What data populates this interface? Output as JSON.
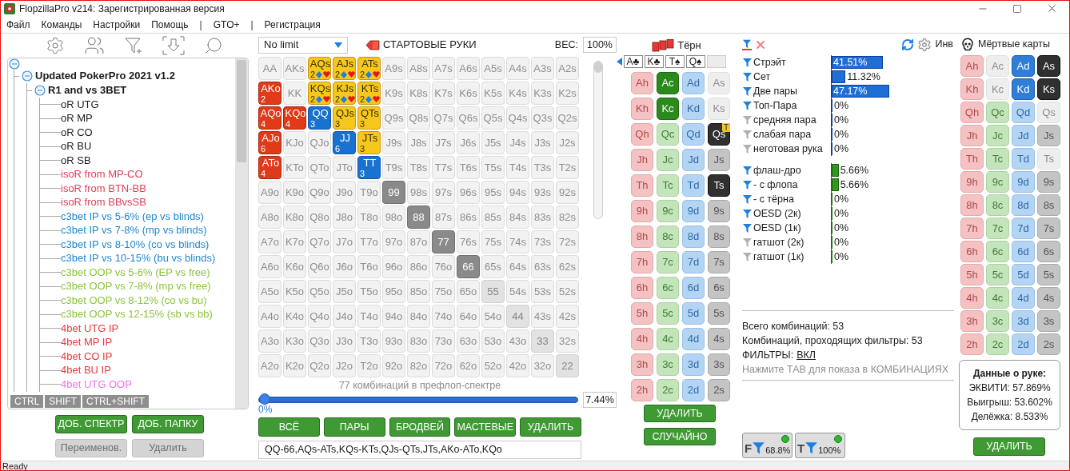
{
  "window": {
    "title": "FlopzillaPro v214: Зарегистрированная версия"
  },
  "menu": [
    {
      "kind": "item",
      "label": "Файл"
    },
    {
      "kind": "item",
      "label": "Команды"
    },
    {
      "kind": "item",
      "label": "Настройки"
    },
    {
      "kind": "item",
      "label": "Помощь"
    },
    {
      "kind": "separator",
      "label": "|"
    },
    {
      "kind": "item",
      "label": "GTO+"
    },
    {
      "kind": "separator",
      "label": "|"
    },
    {
      "kind": "item",
      "label": "Регистрация"
    }
  ],
  "ranges_panel": {
    "tree": {
      "expanded": true,
      "children": [
        {
          "label": "Updated PokerPro 2021 v1.2",
          "expanded": true,
          "children": [
            {
              "label": "R1 and vs 3BET",
              "expanded": true,
              "children": [
                {
                  "label": "oR UTG",
                  "color": "#1a1a1a"
                },
                {
                  "label": "oR MP",
                  "color": "#1a1a1a"
                },
                {
                  "label": "oR CO",
                  "color": "#1a1a1a"
                },
                {
                  "label": "oR BU",
                  "color": "#1a1a1a"
                },
                {
                  "label": "oR SB",
                  "color": "#1a1a1a"
                },
                {
                  "label": "isoR from MP-CO",
                  "color": "#e0405a"
                },
                {
                  "label": "isoR from BTN-BB",
                  "color": "#e0405a"
                },
                {
                  "label": "isoR from BBvsSB",
                  "color": "#e0405a"
                },
                {
                  "label": "c3bet IP vs 5-6% (ep vs blinds)",
                  "color": "#1e88d0"
                },
                {
                  "label": "c3bet IP vs 7-8% (mp vs blinds)",
                  "color": "#1e88d0"
                },
                {
                  "label": "c3bet IP vs 8-10% (co vs blinds)",
                  "color": "#1e88d0"
                },
                {
                  "label": "c3bet IP vs 10-15% (bu vs blinds)",
                  "color": "#1e88d0"
                },
                {
                  "label": "c3bet OOP vs 5-6% (EP vs free)",
                  "color": "#8cc43a"
                },
                {
                  "label": "c3bet OOP vs 7-8% (mp vs free)",
                  "color": "#8cc43a"
                },
                {
                  "label": "c3bet OOP vs 8-12% (co vs bu)",
                  "color": "#8cc43a"
                },
                {
                  "label": "c3bet OOP vs 12-15% (sb vs bb)",
                  "color": "#8cc43a"
                },
                {
                  "label": "4bet UTG IP",
                  "color": "#e83a3a"
                },
                {
                  "label": "4bet MP IP",
                  "color": "#e83a3a"
                },
                {
                  "label": "4bet CO IP",
                  "color": "#e83a3a"
                },
                {
                  "label": "4bet BU IP",
                  "color": "#e83a3a"
                },
                {
                  "label": "4bet UTG OOP",
                  "color": "#ee70ee"
                }
              ]
            }
          ]
        }
      ]
    },
    "modifier_tabs": [
      "CTRL",
      "SHIFT",
      "CTRL+SHIFT"
    ],
    "buttons": [
      {
        "label": "ДОБ. СПЕКТР",
        "disabled": false
      },
      {
        "label": "ДОБ. ПАПКУ",
        "disabled": false
      },
      {
        "label": "Переименов.",
        "disabled": true
      },
      {
        "label": "Удалить",
        "disabled": true
      }
    ]
  },
  "hand_grid": {
    "game_select": "No limit",
    "title": "СТАРТОВЫЕ РУКИ",
    "weight_label": "ВЕС:",
    "weight_value": "100%",
    "weight_slider": {
      "level": 1
    },
    "rows": [
      [
        {
          "label": "AA",
          "kind": "empty"
        },
        {
          "label": "AKs",
          "kind": "empty"
        },
        {
          "label": "AQs",
          "kind": "suited_mixed",
          "count": "2"
        },
        {
          "label": "AJs",
          "kind": "suited_mixed",
          "count": "2"
        },
        {
          "label": "ATs",
          "kind": "suited_mixed",
          "count": "2"
        },
        {
          "label": "A9s",
          "kind": "empty"
        },
        {
          "label": "A8s",
          "kind": "empty"
        },
        {
          "label": "A7s",
          "kind": "empty"
        },
        {
          "label": "A6s",
          "kind": "empty"
        },
        {
          "label": "A5s",
          "kind": "empty"
        },
        {
          "label": "A4s",
          "kind": "empty"
        },
        {
          "label": "A3s",
          "kind": "empty"
        },
        {
          "label": "A2s",
          "kind": "empty"
        }
      ],
      [
        {
          "label": "AKo",
          "kind": "offsuit",
          "count": "2"
        },
        {
          "label": "KK",
          "kind": "empty"
        },
        {
          "label": "KQs",
          "kind": "suited_mixed",
          "count": "2"
        },
        {
          "label": "KJs",
          "kind": "suited_mixed",
          "count": "2"
        },
        {
          "label": "KTs",
          "kind": "suited_mixed",
          "count": "2"
        },
        {
          "label": "K9s",
          "kind": "empty"
        },
        {
          "label": "K8s",
          "kind": "empty"
        },
        {
          "label": "K7s",
          "kind": "empty"
        },
        {
          "label": "K6s",
          "kind": "empty"
        },
        {
          "label": "K5s",
          "kind": "empty"
        },
        {
          "label": "K4s",
          "kind": "empty"
        },
        {
          "label": "K3s",
          "kind": "empty"
        },
        {
          "label": "K2s",
          "kind": "empty"
        }
      ],
      [
        {
          "label": "AQo",
          "kind": "offsuit",
          "count": "4"
        },
        {
          "label": "KQo",
          "kind": "offsuit",
          "count": "4"
        },
        {
          "label": "QQ",
          "kind": "pair",
          "count": "3"
        },
        {
          "label": "QJs",
          "kind": "suited",
          "count": "3"
        },
        {
          "label": "QTs",
          "kind": "suited",
          "count": "3"
        },
        {
          "label": "Q9s",
          "kind": "empty"
        },
        {
          "label": "Q8s",
          "kind": "empty"
        },
        {
          "label": "Q7s",
          "kind": "empty"
        },
        {
          "label": "Q6s",
          "kind": "empty"
        },
        {
          "label": "Q5s",
          "kind": "empty"
        },
        {
          "label": "Q4s",
          "kind": "empty"
        },
        {
          "label": "Q3s",
          "kind": "empty"
        },
        {
          "label": "Q2s",
          "kind": "empty"
        }
      ],
      [
        {
          "label": "AJo",
          "kind": "offsuit",
          "count": "6"
        },
        {
          "label": "KJo",
          "kind": "empty"
        },
        {
          "label": "QJo",
          "kind": "empty"
        },
        {
          "label": "JJ",
          "kind": "pair",
          "count": "6"
        },
        {
          "label": "JTs",
          "kind": "suited",
          "count": "3"
        },
        {
          "label": "J9s",
          "kind": "empty"
        },
        {
          "label": "J8s",
          "kind": "empty"
        },
        {
          "label": "J7s",
          "kind": "empty"
        },
        {
          "label": "J6s",
          "kind": "empty"
        },
        {
          "label": "J5s",
          "kind": "empty"
        },
        {
          "label": "J4s",
          "kind": "empty"
        },
        {
          "label": "J3s",
          "kind": "empty"
        },
        {
          "label": "J2s",
          "kind": "empty"
        }
      ],
      [
        {
          "label": "ATo",
          "kind": "offsuit",
          "count": "4"
        },
        {
          "label": "KTo",
          "kind": "empty"
        },
        {
          "label": "QTo",
          "kind": "empty"
        },
        {
          "label": "JTo",
          "kind": "empty"
        },
        {
          "label": "TT",
          "kind": "pair",
          "count": "3"
        },
        {
          "label": "T9s",
          "kind": "empty"
        },
        {
          "label": "T8s",
          "kind": "empty"
        },
        {
          "label": "T7s",
          "kind": "empty"
        },
        {
          "label": "T6s",
          "kind": "empty"
        },
        {
          "label": "T5s",
          "kind": "empty"
        },
        {
          "label": "T4s",
          "kind": "empty"
        },
        {
          "label": "T3s",
          "kind": "empty"
        },
        {
          "label": "T2s",
          "kind": "empty"
        }
      ],
      [
        {
          "label": "A9o",
          "kind": "empty"
        },
        {
          "label": "K9o",
          "kind": "empty"
        },
        {
          "label": "Q9o",
          "kind": "empty"
        },
        {
          "label": "J9o",
          "kind": "empty"
        },
        {
          "label": "T9o",
          "kind": "empty"
        },
        {
          "label": "99",
          "kind": "dead"
        },
        {
          "label": "98s",
          "kind": "empty"
        },
        {
          "label": "97s",
          "kind": "empty"
        },
        {
          "label": "96s",
          "kind": "empty"
        },
        {
          "label": "95s",
          "kind": "empty"
        },
        {
          "label": "94s",
          "kind": "empty"
        },
        {
          "label": "93s",
          "kind": "empty"
        },
        {
          "label": "92s",
          "kind": "empty"
        }
      ],
      [
        {
          "label": "A8o",
          "kind": "empty"
        },
        {
          "label": "K8o",
          "kind": "empty"
        },
        {
          "label": "Q8o",
          "kind": "empty"
        },
        {
          "label": "J8o",
          "kind": "empty"
        },
        {
          "label": "T8o",
          "kind": "empty"
        },
        {
          "label": "98o",
          "kind": "empty"
        },
        {
          "label": "88",
          "kind": "dead"
        },
        {
          "label": "87s",
          "kind": "empty"
        },
        {
          "label": "86s",
          "kind": "empty"
        },
        {
          "label": "85s",
          "kind": "empty"
        },
        {
          "label": "84s",
          "kind": "empty"
        },
        {
          "label": "83s",
          "kind": "empty"
        },
        {
          "label": "82s",
          "kind": "empty"
        }
      ],
      [
        {
          "label": "A7o",
          "kind": "empty"
        },
        {
          "label": "K7o",
          "kind": "empty"
        },
        {
          "label": "Q7o",
          "kind": "empty"
        },
        {
          "label": "J7o",
          "kind": "empty"
        },
        {
          "label": "T7o",
          "kind": "empty"
        },
        {
          "label": "97o",
          "kind": "empty"
        },
        {
          "label": "87o",
          "kind": "empty"
        },
        {
          "label": "77",
          "kind": "dead"
        },
        {
          "label": "76s",
          "kind": "empty"
        },
        {
          "label": "75s",
          "kind": "empty"
        },
        {
          "label": "74s",
          "kind": "empty"
        },
        {
          "label": "73s",
          "kind": "empty"
        },
        {
          "label": "72s",
          "kind": "empty"
        }
      ],
      [
        {
          "label": "A6o",
          "kind": "empty"
        },
        {
          "label": "K6o",
          "kind": "empty"
        },
        {
          "label": "Q6o",
          "kind": "empty"
        },
        {
          "label": "J6o",
          "kind": "empty"
        },
        {
          "label": "T6o",
          "kind": "empty"
        },
        {
          "label": "96o",
          "kind": "empty"
        },
        {
          "label": "86o",
          "kind": "empty"
        },
        {
          "label": "76o",
          "kind": "empty"
        },
        {
          "label": "66",
          "kind": "dead"
        },
        {
          "label": "65s",
          "kind": "empty"
        },
        {
          "label": "64s",
          "kind": "empty"
        },
        {
          "label": "63s",
          "kind": "empty"
        },
        {
          "label": "62s",
          "kind": "empty"
        }
      ],
      [
        {
          "label": "A5o",
          "kind": "empty"
        },
        {
          "label": "K5o",
          "kind": "empty"
        },
        {
          "label": "Q5o",
          "kind": "empty"
        },
        {
          "label": "J5o",
          "kind": "empty"
        },
        {
          "label": "T5o",
          "kind": "empty"
        },
        {
          "label": "95o",
          "kind": "empty"
        },
        {
          "label": "85o",
          "kind": "empty"
        },
        {
          "label": "75o",
          "kind": "empty"
        },
        {
          "label": "65o",
          "kind": "empty"
        },
        {
          "label": "55",
          "kind": "dim"
        },
        {
          "label": "54s",
          "kind": "empty"
        },
        {
          "label": "53s",
          "kind": "empty"
        },
        {
          "label": "52s",
          "kind": "empty"
        }
      ],
      [
        {
          "label": "A4o",
          "kind": "empty"
        },
        {
          "label": "K4o",
          "kind": "empty"
        },
        {
          "label": "Q4o",
          "kind": "empty"
        },
        {
          "label": "J4o",
          "kind": "empty"
        },
        {
          "label": "T4o",
          "kind": "empty"
        },
        {
          "label": "94o",
          "kind": "empty"
        },
        {
          "label": "84o",
          "kind": "empty"
        },
        {
          "label": "74o",
          "kind": "empty"
        },
        {
          "label": "64o",
          "kind": "empty"
        },
        {
          "label": "54o",
          "kind": "empty"
        },
        {
          "label": "44",
          "kind": "dim"
        },
        {
          "label": "43s",
          "kind": "empty"
        },
        {
          "label": "42s",
          "kind": "empty"
        }
      ],
      [
        {
          "label": "A3o",
          "kind": "empty"
        },
        {
          "label": "K3o",
          "kind": "empty"
        },
        {
          "label": "Q3o",
          "kind": "empty"
        },
        {
          "label": "J3o",
          "kind": "empty"
        },
        {
          "label": "T3o",
          "kind": "empty"
        },
        {
          "label": "93o",
          "kind": "empty"
        },
        {
          "label": "83o",
          "kind": "empty"
        },
        {
          "label": "73o",
          "kind": "empty"
        },
        {
          "label": "63o",
          "kind": "empty"
        },
        {
          "label": "53o",
          "kind": "empty"
        },
        {
          "label": "43o",
          "kind": "empty"
        },
        {
          "label": "33",
          "kind": "dim"
        },
        {
          "label": "32s",
          "kind": "empty"
        }
      ],
      [
        {
          "label": "A2o",
          "kind": "empty"
        },
        {
          "label": "K2o",
          "kind": "empty"
        },
        {
          "label": "Q2o",
          "kind": "empty"
        },
        {
          "label": "J2o",
          "kind": "empty"
        },
        {
          "label": "T2o",
          "kind": "empty"
        },
        {
          "label": "92o",
          "kind": "empty"
        },
        {
          "label": "82o",
          "kind": "empty"
        },
        {
          "label": "72o",
          "kind": "empty"
        },
        {
          "label": "62o",
          "kind": "empty"
        },
        {
          "label": "52o",
          "kind": "empty"
        },
        {
          "label": "42o",
          "kind": "empty"
        },
        {
          "label": "32o",
          "kind": "empty"
        },
        {
          "label": "22",
          "kind": "dim"
        }
      ]
    ],
    "combo_caption": "77 комбинаций в префлоп-спектре",
    "slider": {
      "level": 0
    },
    "slider_reading": "0%",
    "percent_value": "7.44%",
    "buttons": [
      "ВСЁ",
      "ПАРЫ",
      "БРОДВЕЙ",
      "МАСТЕВЫЕ",
      "УДАЛИТЬ"
    ],
    "range_text": "QQ-66,AQs-ATs,KQs-KTs,QJs-QTs,JTs,AKo-ATo,KQo"
  },
  "turn": {
    "title": "Тёрн",
    "board": [
      "A♣",
      "K♣",
      "T♠",
      "Q♠"
    ],
    "rows": [
      [
        {
          "label": "Ah",
          "kind": "normal"
        },
        {
          "label": "Ac",
          "kind": "selected"
        },
        {
          "label": "Ad",
          "kind": "normal"
        },
        {
          "label": "As",
          "kind": "used"
        }
      ],
      [
        {
          "label": "Kh",
          "kind": "normal"
        },
        {
          "label": "Kc",
          "kind": "selected"
        },
        {
          "label": "Kd",
          "kind": "normal"
        },
        {
          "label": "Ks",
          "kind": "used"
        }
      ],
      [
        {
          "label": "Qh",
          "kind": "normal"
        },
        {
          "label": "Qc",
          "kind": "normal"
        },
        {
          "label": "Qd",
          "kind": "normal"
        },
        {
          "label": "Qs",
          "kind": "board",
          "badge": "T"
        }
      ],
      [
        {
          "label": "Jh",
          "kind": "normal"
        },
        {
          "label": "Jc",
          "kind": "normal"
        },
        {
          "label": "Jd",
          "kind": "normal"
        },
        {
          "label": "Js",
          "kind": "normal"
        }
      ],
      [
        {
          "label": "Th",
          "kind": "normal"
        },
        {
          "label": "Tc",
          "kind": "normal"
        },
        {
          "label": "Td",
          "kind": "normal"
        },
        {
          "label": "Ts",
          "kind": "board"
        }
      ],
      [
        {
          "label": "9h",
          "kind": "normal"
        },
        {
          "label": "9c",
          "kind": "normal"
        },
        {
          "label": "9d",
          "kind": "normal"
        },
        {
          "label": "9s",
          "kind": "normal"
        }
      ],
      [
        {
          "label": "8h",
          "kind": "normal"
        },
        {
          "label": "8c",
          "kind": "normal"
        },
        {
          "label": "8d",
          "kind": "normal"
        },
        {
          "label": "8s",
          "kind": "normal"
        }
      ],
      [
        {
          "label": "7h",
          "kind": "normal"
        },
        {
          "label": "7c",
          "kind": "normal"
        },
        {
          "label": "7d",
          "kind": "normal"
        },
        {
          "label": "7s",
          "kind": "normal"
        }
      ],
      [
        {
          "label": "6h",
          "kind": "normal"
        },
        {
          "label": "6c",
          "kind": "normal"
        },
        {
          "label": "6d",
          "kind": "normal"
        },
        {
          "label": "6s",
          "kind": "normal"
        }
      ],
      [
        {
          "label": "5h",
          "kind": "normal"
        },
        {
          "label": "5c",
          "kind": "normal"
        },
        {
          "label": "5d",
          "kind": "normal"
        },
        {
          "label": "5s",
          "kind": "normal"
        }
      ],
      [
        {
          "label": "4h",
          "kind": "normal"
        },
        {
          "label": "4c",
          "kind": "normal"
        },
        {
          "label": "4d",
          "kind": "normal"
        },
        {
          "label": "4s",
          "kind": "normal"
        }
      ],
      [
        {
          "label": "3h",
          "kind": "normal"
        },
        {
          "label": "3c",
          "kind": "normal"
        },
        {
          "label": "3d",
          "kind": "normal"
        },
        {
          "label": "3s",
          "kind": "normal"
        }
      ],
      [
        {
          "label": "2h",
          "kind": "normal"
        },
        {
          "label": "2c",
          "kind": "normal"
        },
        {
          "label": "2d",
          "kind": "normal"
        },
        {
          "label": "2s",
          "kind": "normal"
        }
      ]
    ],
    "buttons": [
      "УДАЛИТЬ",
      "СЛУЧАЙНО"
    ]
  },
  "stats": {
    "account": "Инв",
    "groups": [
      {
        "kind": "made",
        "items": [
          {
            "label": "Стрэйт",
            "filter_on": true,
            "value": "41.51%",
            "level": 0.4151
          },
          {
            "label": "Сет",
            "filter_on": true,
            "value": "11.32%",
            "level": 0.1132
          },
          {
            "label": "Две пары",
            "filter_on": true,
            "value": "47.17%",
            "level": 0.4717
          },
          {
            "label": "Топ-Пара",
            "filter_on": true,
            "value": "0%",
            "level": 0
          },
          {
            "label": "средняя пара",
            "filter_on": false,
            "value": "0%",
            "level": 0
          },
          {
            "label": "слабая пара",
            "filter_on": false,
            "value": "0%",
            "level": 0
          },
          {
            "label": "неготовая рука",
            "filter_on": false,
            "value": "0%",
            "level": 0
          }
        ]
      },
      {
        "kind": "draw",
        "items": [
          {
            "label": "флаш-дро",
            "filter_on": true,
            "value": "5.66%",
            "level": 0.0566
          },
          {
            "label": "- с флопа",
            "filter_on": true,
            "value": "5.66%",
            "level": 0.0566
          },
          {
            "label": "- с тёрна",
            "filter_on": true,
            "value": "0%",
            "level": 0
          },
          {
            "label": "OESD (2к)",
            "filter_on": true,
            "value": "0%",
            "level": 0
          },
          {
            "label": "OESD (1к)",
            "filter_on": true,
            "value": "0%",
            "level": 0
          },
          {
            "label": "гатшот (2к)",
            "filter_on": false,
            "value": "0%",
            "level": 0
          },
          {
            "label": "гатшот (1к)",
            "filter_on": false,
            "value": "0%",
            "level": 0
          }
        ]
      }
    ],
    "totals": [
      "Всего комбинаций: 53",
      "Комбинаций, проходящих фильтры: 53"
    ],
    "filters_label": "ФИЛЬТРЫ:",
    "filters_state": "ВКЛ",
    "hint": "Нажмите ТАВ для показа в КОМБИНАЦИЯХ",
    "filter_toggles": [
      {
        "letter": "F",
        "value": "68.8%",
        "on": true
      },
      {
        "letter": "T",
        "value": "100%",
        "on": true
      }
    ]
  },
  "dead_cards": {
    "title": "Мёртвые карты",
    "rows": [
      [
        {
          "label": "Ah",
          "kind": "normal"
        },
        {
          "label": "Ac",
          "kind": "used"
        },
        {
          "label": "Ad",
          "kind": "selected"
        },
        {
          "label": "As",
          "kind": "board"
        }
      ],
      [
        {
          "label": "Kh",
          "kind": "normal"
        },
        {
          "label": "Kc",
          "kind": "used"
        },
        {
          "label": "Kd",
          "kind": "selected"
        },
        {
          "label": "Ks",
          "kind": "board"
        }
      ],
      [
        {
          "label": "Qh",
          "kind": "normal"
        },
        {
          "label": "Qc",
          "kind": "normal"
        },
        {
          "label": "Qd",
          "kind": "normal"
        },
        {
          "label": "Qs",
          "kind": "used"
        }
      ],
      [
        {
          "label": "Jh",
          "kind": "normal"
        },
        {
          "label": "Jc",
          "kind": "normal"
        },
        {
          "label": "Jd",
          "kind": "normal"
        },
        {
          "label": "Js",
          "kind": "normal"
        }
      ],
      [
        {
          "label": "Th",
          "kind": "normal"
        },
        {
          "label": "Tc",
          "kind": "normal"
        },
        {
          "label": "Td",
          "kind": "normal"
        },
        {
          "label": "Ts",
          "kind": "used"
        }
      ],
      [
        {
          "label": "9h",
          "kind": "normal"
        },
        {
          "label": "9c",
          "kind": "normal"
        },
        {
          "label": "9d",
          "kind": "normal"
        },
        {
          "label": "9s",
          "kind": "normal"
        }
      ],
      [
        {
          "label": "8h",
          "kind": "normal"
        },
        {
          "label": "8c",
          "kind": "normal"
        },
        {
          "label": "8d",
          "kind": "normal"
        },
        {
          "label": "8s",
          "kind": "normal"
        }
      ],
      [
        {
          "label": "7h",
          "kind": "normal"
        },
        {
          "label": "7c",
          "kind": "normal"
        },
        {
          "label": "7d",
          "kind": "normal"
        },
        {
          "label": "7s",
          "kind": "normal"
        }
      ],
      [
        {
          "label": "6h",
          "kind": "normal"
        },
        {
          "label": "6c",
          "kind": "normal"
        },
        {
          "label": "6d",
          "kind": "normal"
        },
        {
          "label": "6s",
          "kind": "normal"
        }
      ],
      [
        {
          "label": "5h",
          "kind": "normal"
        },
        {
          "label": "5c",
          "kind": "normal"
        },
        {
          "label": "5d",
          "kind": "normal"
        },
        {
          "label": "5s",
          "kind": "normal"
        }
      ],
      [
        {
          "label": "4h",
          "kind": "normal"
        },
        {
          "label": "4c",
          "kind": "normal"
        },
        {
          "label": "4d",
          "kind": "normal"
        },
        {
          "label": "4s",
          "kind": "normal"
        }
      ],
      [
        {
          "label": "3h",
          "kind": "normal"
        },
        {
          "label": "3c",
          "kind": "normal"
        },
        {
          "label": "3d",
          "kind": "normal"
        },
        {
          "label": "3s",
          "kind": "normal"
        }
      ],
      [
        {
          "label": "2h",
          "kind": "normal"
        },
        {
          "label": "2c",
          "kind": "normal"
        },
        {
          "label": "2d",
          "kind": "normal"
        },
        {
          "label": "2s",
          "kind": "normal"
        }
      ]
    ],
    "hand_data": {
      "title": "Данные о руке:",
      "lines": [
        "ЭКВИТИ: 57.869%",
        "Выигрыш: 53.602%",
        "Делёжка: 8.533%"
      ]
    },
    "button": "УДАЛИТЬ"
  },
  "status_bar": "Ready"
}
